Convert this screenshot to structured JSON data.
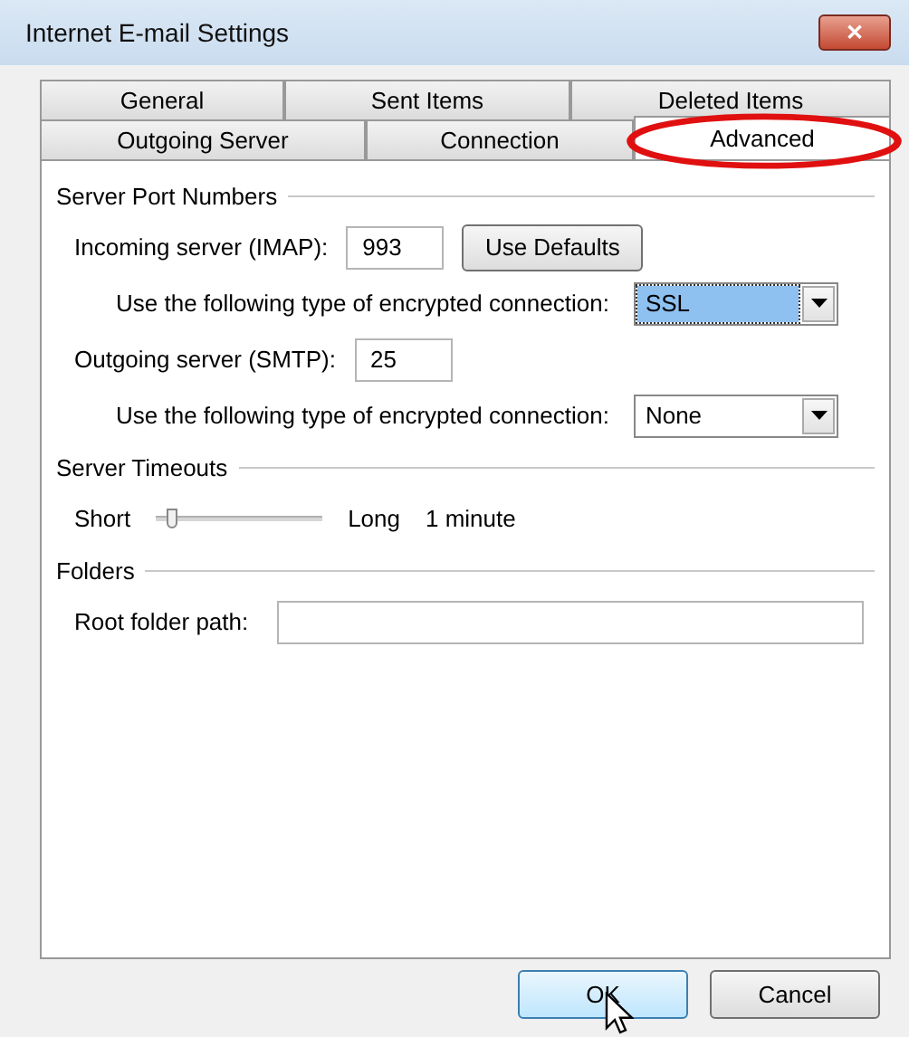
{
  "window": {
    "title": "Internet E-mail Settings",
    "close": "✕"
  },
  "tab_rows": [
    [
      {
        "label": "General",
        "selected": false
      },
      {
        "label": "Sent Items",
        "selected": false
      },
      {
        "label": "Deleted Items",
        "selected": false
      }
    ],
    [
      {
        "label": "Outgoing Server",
        "selected": false
      },
      {
        "label": "Connection",
        "selected": false
      },
      {
        "label": "Advanced",
        "selected": true,
        "highlighted": true
      }
    ]
  ],
  "server_ports": {
    "heading": "Server Port Numbers",
    "incoming_label": "Incoming server (IMAP):",
    "incoming_value": "993",
    "defaults_button": "Use Defaults",
    "incoming_encryption_label": "Use the following type of encrypted connection:",
    "incoming_encryption": {
      "value": "SSL",
      "focused": true
    },
    "outgoing_label": "Outgoing server (SMTP):",
    "outgoing_value": "25",
    "outgoing_encryption_label": "Use the following type of encrypted connection:",
    "outgoing_encryption": {
      "value": "None",
      "focused": false
    }
  },
  "timeouts": {
    "heading": "Server Timeouts",
    "short_label": "Short",
    "level": 0.1,
    "long_label": "Long",
    "reading": "1 minute"
  },
  "folders": {
    "heading": "Folders",
    "root_label": "Root folder path:"
  },
  "buttons": [
    {
      "label": "OK",
      "hovered": true
    },
    {
      "label": "Cancel",
      "hovered": false
    }
  ]
}
